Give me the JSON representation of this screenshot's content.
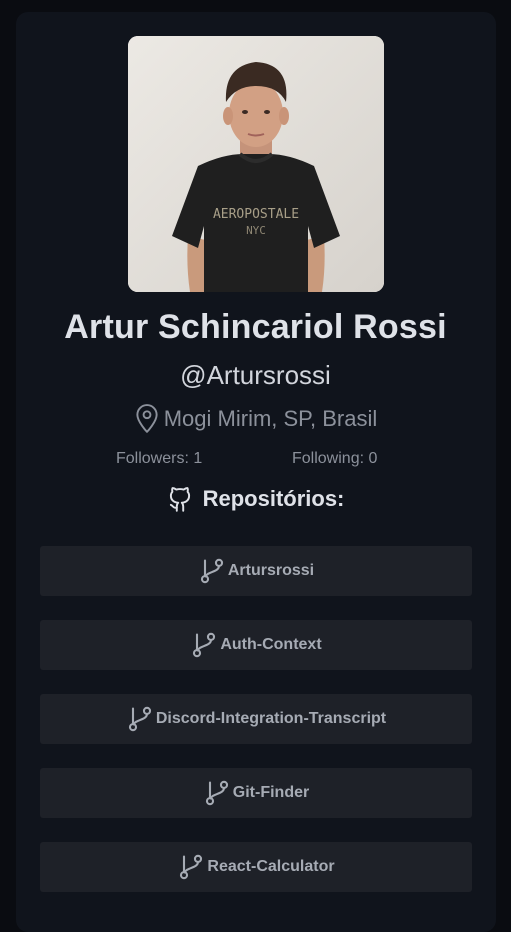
{
  "profile": {
    "name": "Artur Schincariol Rossi",
    "login": "@Artursrossi",
    "location": "Mogi Mirim, SP, Brasil",
    "followers": "Followers: 1",
    "following": "Following: 0",
    "avatar_shirt_text_top": "AEROPOSTALE",
    "avatar_shirt_text_bottom": "NYC"
  },
  "repositories": {
    "title": "Repositórios:",
    "items": [
      "Artursrossi",
      "Auth-Context",
      "Discord-Integration-Transcript",
      "Git-Finder",
      "React-Calculator"
    ]
  },
  "icons": {
    "location": "map-pin-icon",
    "github": "github-icon",
    "branch": "git-branch-icon"
  },
  "colors": {
    "background": "#0a0c11",
    "card": "#10141c",
    "repo_button": "#1e2128",
    "text_primary": "#dfe2e8",
    "text_muted": "#8c919b"
  }
}
